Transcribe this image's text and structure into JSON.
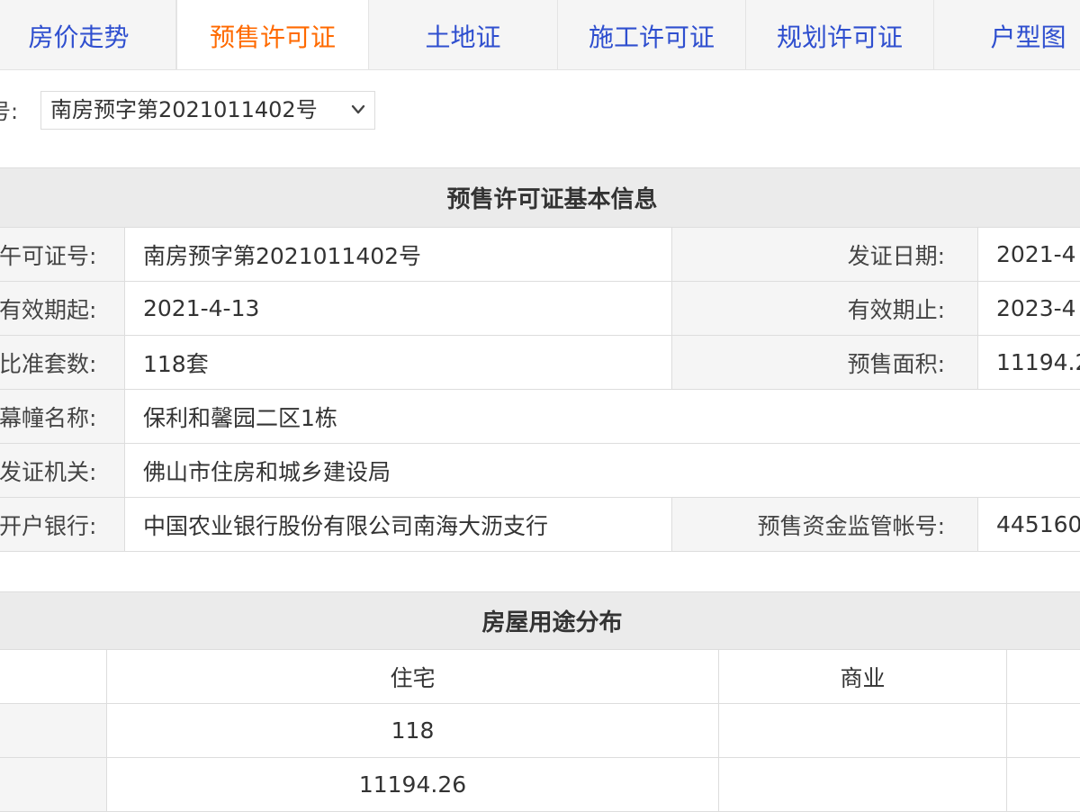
{
  "tabs": [
    {
      "label": "房价走势",
      "active": false
    },
    {
      "label": "预售许可证",
      "active": true
    },
    {
      "label": "土地证",
      "active": false
    },
    {
      "label": "施工许可证",
      "active": false
    },
    {
      "label": "规划许可证",
      "active": false
    },
    {
      "label": "户型图",
      "active": false
    }
  ],
  "selector": {
    "label": "号:",
    "value": "南房预字第2021011402号"
  },
  "info": {
    "title": "预售许可证基本信息",
    "license_no_label": "午可证号:",
    "license_no": "南房预字第2021011402号",
    "issue_date_label": "发证日期:",
    "issue_date": "2021-4",
    "valid_from_label": "有效期起:",
    "valid_from": "2021-4-13",
    "valid_to_label": "有效期止:",
    "valid_to": "2023-4",
    "units_label": "比准套数:",
    "units": "118套",
    "presale_area_label": "预售面积:",
    "presale_area": "11194.2",
    "building_label": "幕幢名称:",
    "building": "保利和馨园二区1栋",
    "authority_label": "发证机关:",
    "authority": "佛山市住房和城乡建设局",
    "bank_label": "开户银行:",
    "bank": "中国农业银行股份有限公司南海大沥支行",
    "account_label": "预售资金监管帐号:",
    "account": "445160"
  },
  "usage": {
    "title": "房屋用途分布",
    "columns": [
      "住宅",
      "商业"
    ],
    "rows": [
      {
        "label": "",
        "values": [
          "118",
          ""
        ]
      },
      {
        "label": "",
        "values": [
          "11194.26",
          ""
        ]
      }
    ]
  },
  "colors": {
    "tab_active": "#ff6a00",
    "tab_link": "#2f4fcf",
    "header_bg": "#ebebeb",
    "label_bg": "#f5f5f5"
  },
  "icons": {
    "select_arrow": "chevron-down-icon"
  }
}
